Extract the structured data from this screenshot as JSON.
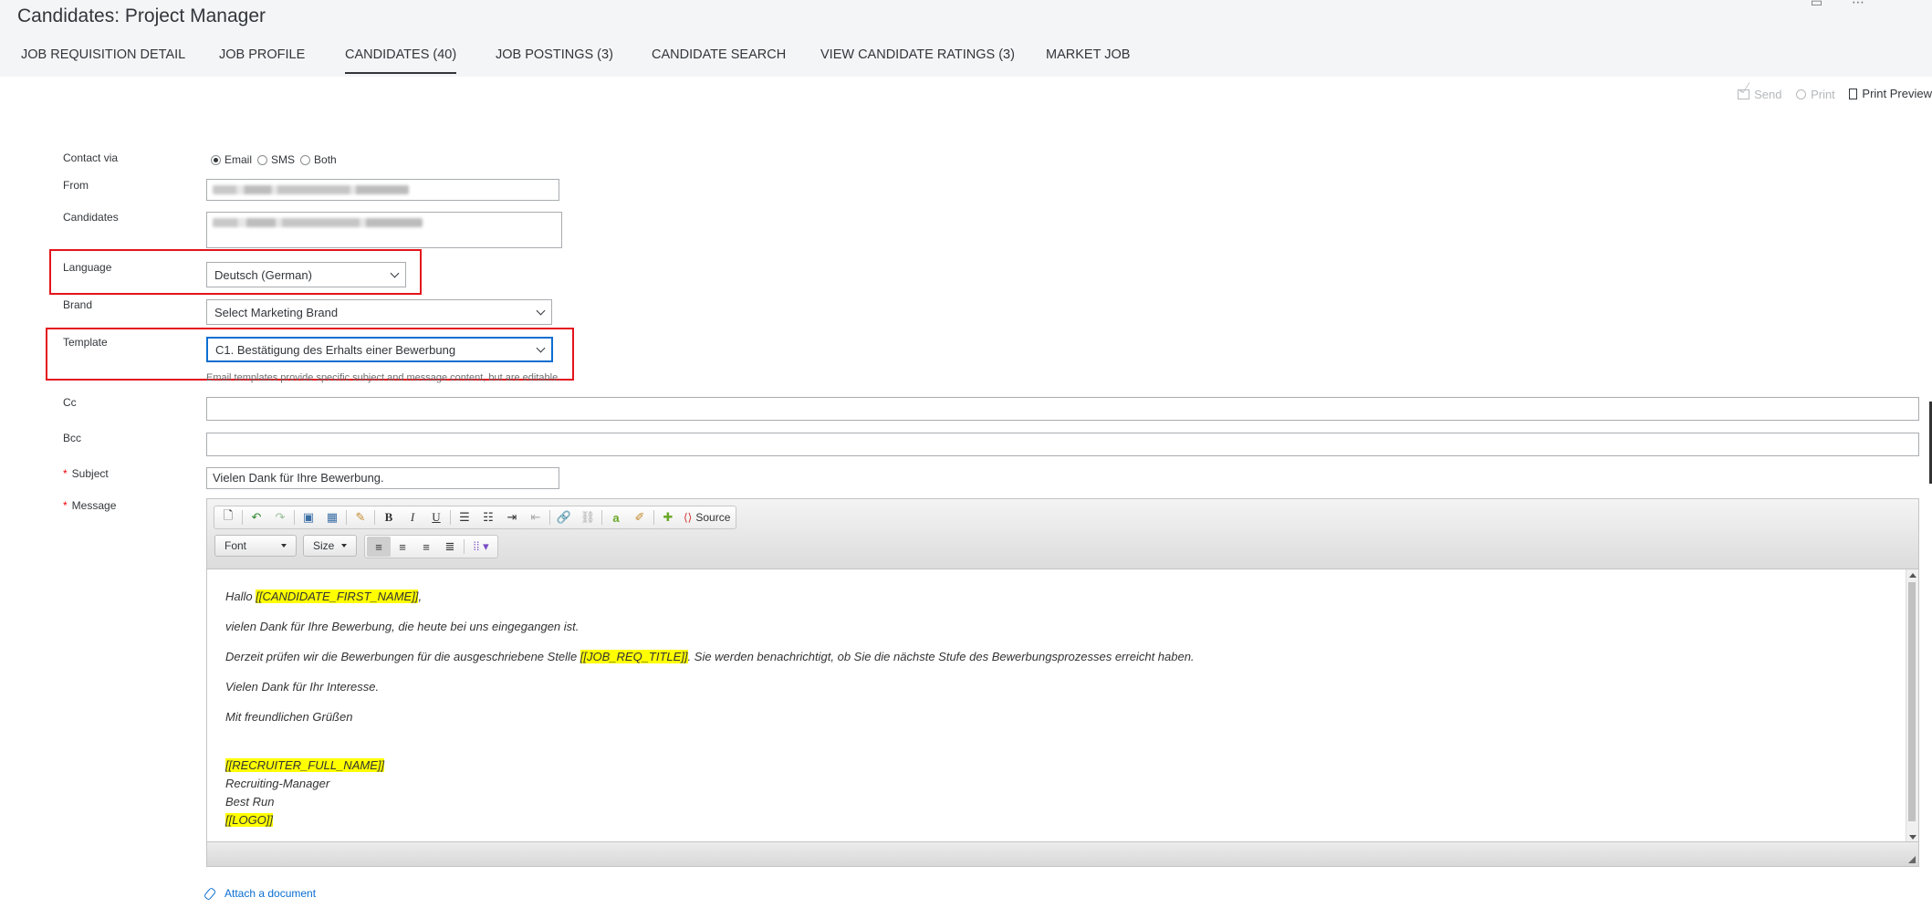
{
  "page": {
    "title": "Candidates: Project Manager"
  },
  "tabs": [
    {
      "label": "JOB REQUISITION DETAIL"
    },
    {
      "label": "JOB PROFILE"
    },
    {
      "label": "CANDIDATES (40)",
      "active": true
    },
    {
      "label": "JOB POSTINGS (3)"
    },
    {
      "label": "CANDIDATE SEARCH"
    },
    {
      "label": "VIEW CANDIDATE RATINGS (3)"
    },
    {
      "label": "MARKET JOB"
    }
  ],
  "actions": {
    "send": "Send",
    "print": "Print",
    "print_preview": "Print Preview"
  },
  "form": {
    "contact_via": {
      "label": "Contact via",
      "options": [
        "Email",
        "SMS",
        "Both"
      ],
      "selected": "Email"
    },
    "from": {
      "label": "From"
    },
    "candidates": {
      "label": "Candidates"
    },
    "language": {
      "label": "Language",
      "value": "Deutsch (German)"
    },
    "brand": {
      "label": "Brand",
      "value": "Select Marketing Brand"
    },
    "template": {
      "label": "Template",
      "value": "C1. Bestätigung des Erhalts einer Bewerbung",
      "hint": "Email templates provide specific subject and message content, but are editable."
    },
    "cc": {
      "label": "Cc",
      "value": ""
    },
    "bcc": {
      "label": "Bcc",
      "value": ""
    },
    "subject": {
      "label": "Subject",
      "value": "Vielen Dank für Ihre Bewerbung."
    },
    "message": {
      "label": "Message"
    }
  },
  "editor": {
    "font_combo": "Font",
    "size_combo": "Size",
    "source_label": "Source",
    "bold": "B",
    "italic": "I",
    "underline": "U",
    "body": {
      "greeting": "Hallo ",
      "token_first_name": "[[CANDIDATE_FIRST_NAME]]",
      "greeting_end": ",",
      "line1": "vielen Dank für Ihre Bewerbung, die heute bei uns eingegangen ist.",
      "line2_pre": "Derzeit prüfen wir die Bewerbungen für die ausgeschriebene Stelle  ",
      "token_job_title": "[[JOB_REQ_TITLE]]",
      "line2_post": ".  Sie werden benachrichtigt, ob Sie die nächste Stufe des Bewerbungsprozesses erreicht haben.",
      "line3": "Vielen Dank für Ihr Interesse.",
      "line4": "Mit freundlichen Grüßen",
      "token_recruiter": "[[RECRUITER_FULL_NAME]]",
      "role": "Recruiting-Manager",
      "company": "Best Run",
      "token_logo": "[[LOGO]]"
    }
  },
  "attach": {
    "label": "Attach a document"
  },
  "colors": {
    "accent": "#0a6ed1",
    "highlight_box": "#e4141c",
    "token_highlight": "#ffff00"
  }
}
